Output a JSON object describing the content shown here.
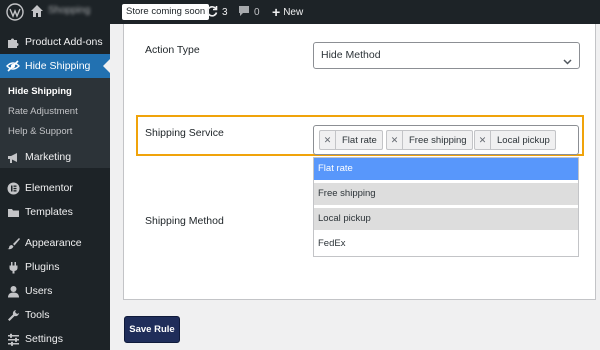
{
  "admin_bar": {
    "site_name": "Shopping",
    "badge": "Store coming soon",
    "updates_count": "3",
    "comments_count": "0",
    "new_label": "New"
  },
  "sidebar": {
    "items": [
      {
        "label": "Product Add-ons",
        "icon": "puzzle-icon"
      },
      {
        "label": "Hide Shipping",
        "icon": "eye-slash-icon"
      },
      {
        "label": "Marketing",
        "icon": "megaphone-icon"
      },
      {
        "label": "Elementor",
        "icon": "elementor-icon"
      },
      {
        "label": "Templates",
        "icon": "folder-icon"
      },
      {
        "label": "Appearance",
        "icon": "paintbrush-icon"
      },
      {
        "label": "Plugins",
        "icon": "plug-icon"
      },
      {
        "label": "Users",
        "icon": "user-icon"
      },
      {
        "label": "Tools",
        "icon": "wrench-icon"
      },
      {
        "label": "Settings",
        "icon": "settings-icon"
      }
    ],
    "submenu": [
      "Hide Shipping",
      "Rate Adjustment",
      "Help & Support"
    ]
  },
  "form": {
    "action_type_label": "Action Type",
    "action_type_value": "Hide Method",
    "shipping_service_label": "Shipping Service",
    "shipping_service_tags": [
      "Flat rate",
      "Free shipping",
      "Local pickup"
    ],
    "shipping_method_label": "Shipping Method",
    "dropdown_options": [
      "Flat rate",
      "Free shipping",
      "Local pickup",
      "FedEx"
    ],
    "save_label": "Save Rule"
  },
  "colors": {
    "admin_bg": "#1d2327",
    "active_menu": "#2271b1",
    "highlight_border": "#f0a30a",
    "dropdown_highlight": "#5897fb",
    "save_button": "#1f2d5a"
  }
}
